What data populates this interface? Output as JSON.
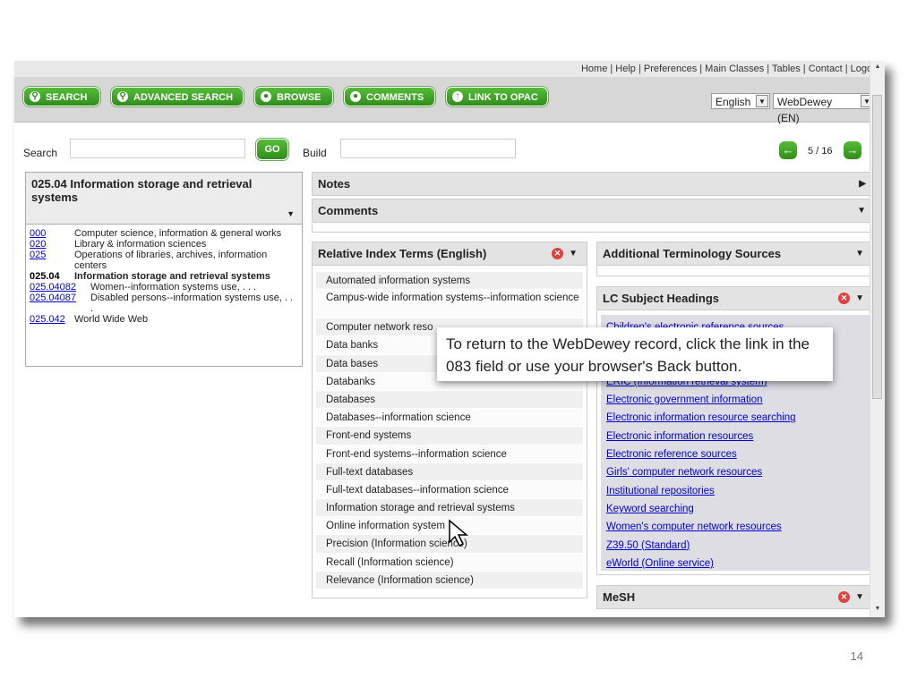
{
  "toplinks": "Home | Help | Preferences | Main Classes | Tables | Contact | Logoff",
  "toolbar": {
    "search": "SEARCH",
    "advanced": "ADVANCED SEARCH",
    "browse": "BROWSE",
    "comments": "COMMENTS",
    "opac": "LINK TO OPAC",
    "language": "English",
    "edition": "WebDewey (EN)"
  },
  "searchbar": {
    "search_label": "Search",
    "go": "GO",
    "build_label": "Build",
    "pager": "5 / 16"
  },
  "record": {
    "title": "025.04 Information storage and retrieval systems",
    "hierarchy": [
      {
        "num": "000",
        "text": "Computer science, information & general works"
      },
      {
        "num": "020",
        "text": "Library & information sciences"
      },
      {
        "num": "025",
        "text": "Operations of libraries, archives, information centers"
      },
      {
        "num": "025.04",
        "text": "Information storage and retrieval systems"
      },
      {
        "num": "025.04082",
        "text": "Women--information systems use, . . ."
      },
      {
        "num": "025.04087",
        "text": "Disabled persons--information systems use, . . ."
      },
      {
        "num": "025.042",
        "text": "World Wide Web"
      }
    ]
  },
  "panels": {
    "notes": "Notes",
    "comments": "Comments",
    "relative": "Relative Index Terms (English)",
    "additional": "Additional Terminology Sources",
    "lc": "LC Subject Headings",
    "mesh": "MeSH"
  },
  "relative_terms": [
    "Automated information systems",
    "Campus-wide information systems--information science",
    "Computer network reso",
    "Data banks",
    "Data bases",
    "Databanks",
    "Databases",
    "Databases--information science",
    "Front-end systems",
    "Front-end systems--information science",
    "Full-text databases",
    "Full-text databases--information science",
    "Information storage and retrieval systems",
    "Online information system",
    "Precision (Information science)",
    "Recall (Information science)",
    "Relevance (Information science)"
  ],
  "lc_headings": [
    "Children's electronic reference sources",
    "",
    "",
    "ERIC (Information retrieval system)",
    "Electronic government information",
    "Electronic information resource searching",
    "Electronic information resources",
    "Electronic reference sources",
    "Girls' computer network resources",
    "Institutional repositories",
    "Keyword searching",
    "Women's computer network resources",
    "Z39.50 (Standard)",
    "eWorld (Online service)"
  ],
  "callout": "To return to the WebDewey record, click the link in the 083 field or use your browser's Back button.",
  "slide_number": "14"
}
